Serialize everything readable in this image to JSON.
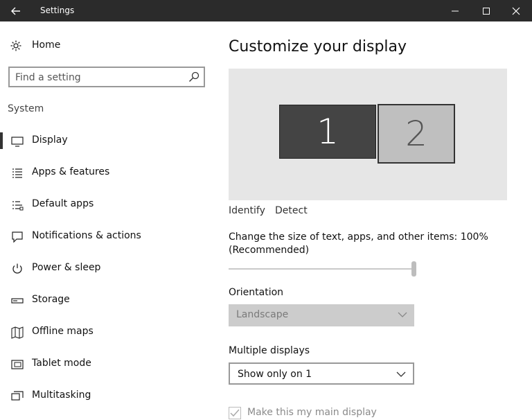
{
  "window": {
    "title": "Settings"
  },
  "sidebar": {
    "home_label": "Home",
    "search_placeholder": "Find a setting",
    "section_label": "System",
    "items": [
      {
        "label": "Display",
        "icon": "monitor-icon"
      },
      {
        "label": "Apps & features",
        "icon": "list-icon"
      },
      {
        "label": "Default apps",
        "icon": "default-apps-icon"
      },
      {
        "label": "Notifications & actions",
        "icon": "notification-icon"
      },
      {
        "label": "Power & sleep",
        "icon": "power-icon"
      },
      {
        "label": "Storage",
        "icon": "storage-icon"
      },
      {
        "label": "Offline maps",
        "icon": "map-icon"
      },
      {
        "label": "Tablet mode",
        "icon": "tablet-icon"
      },
      {
        "label": "Multitasking",
        "icon": "multitasking-icon"
      }
    ],
    "selected_index": 0
  },
  "main": {
    "title": "Customize your display",
    "monitors": {
      "primary": "1",
      "secondary": "2"
    },
    "identify_label": "Identify",
    "detect_label": "Detect",
    "scale_text": "Change the size of text, apps, and other items: 100% (Recommended)",
    "scale_value_percent": 100,
    "orientation_label": "Orientation",
    "orientation_value": "Landscape",
    "multiple_displays_label": "Multiple displays",
    "multiple_displays_value": "Show only on 1",
    "main_display_label": "Make this my main display",
    "main_display_checked": true
  },
  "colors": {
    "titlebar": "#2b2b2b",
    "monitor_primary": "#444444",
    "monitor_secondary": "#bfbfbf",
    "disabled_select": "#cccccc"
  }
}
